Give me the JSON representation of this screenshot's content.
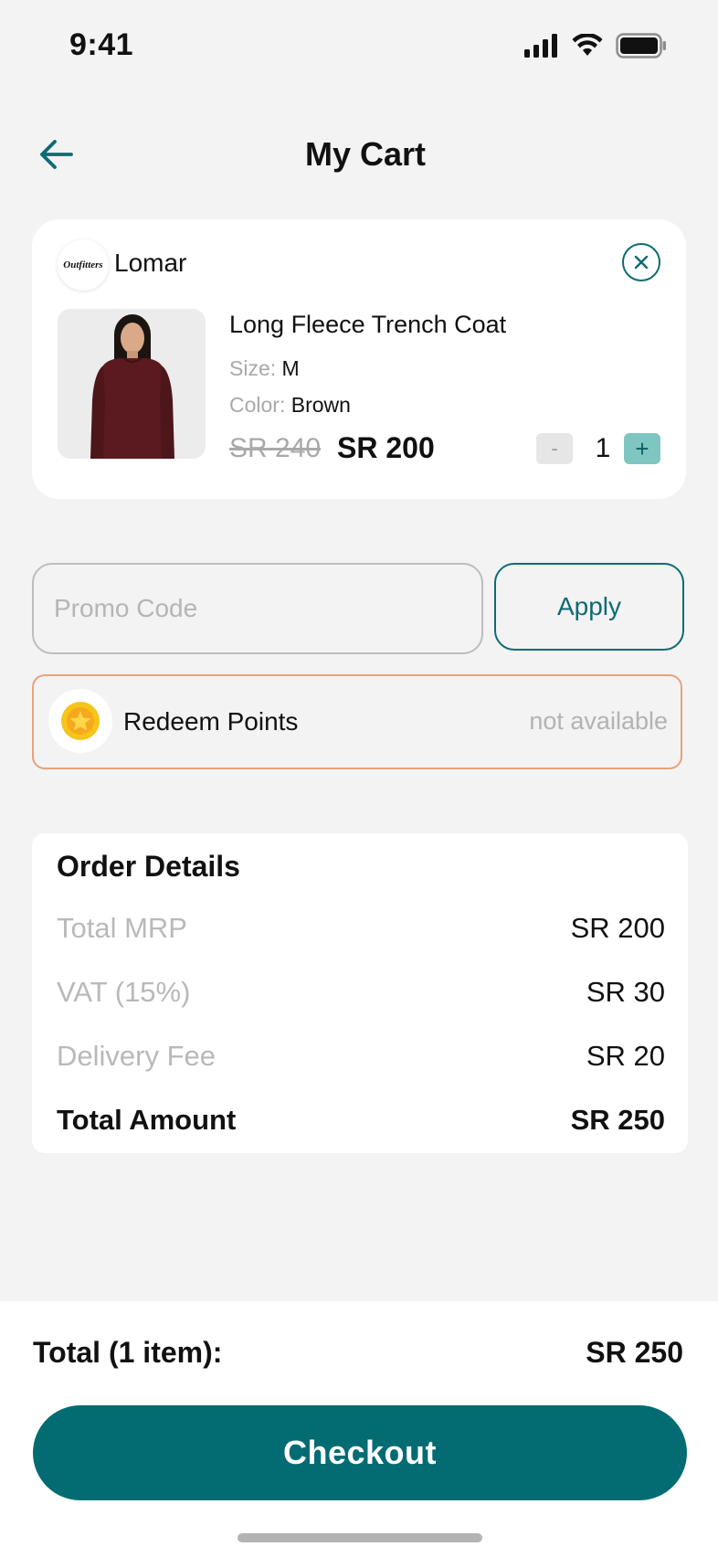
{
  "status_bar": {
    "time": "9:41",
    "icons": [
      "cellular-signal-icon",
      "wifi-icon",
      "battery-icon"
    ]
  },
  "header": {
    "title": "My Cart",
    "back_icon": "arrow-left-icon"
  },
  "cart": {
    "store": {
      "logo_text": "Outfitters",
      "name": "Lomar",
      "remove_icon": "close-circle-icon"
    },
    "item": {
      "name": "Long Fleece Trench Coat",
      "size_label": "Size:",
      "size_value": "M",
      "color_label": "Color:",
      "color_value": "Brown",
      "old_price": "SR 240",
      "price": "SR 200",
      "qty_minus": "-",
      "quantity": "1",
      "qty_plus": "+"
    }
  },
  "promo": {
    "placeholder": "Promo Code",
    "value": "",
    "apply_label": "Apply"
  },
  "redeem": {
    "icon": "star-coin-icon",
    "label": "Redeem Points",
    "status": "not available"
  },
  "order_details": {
    "title": "Order Details",
    "rows": [
      {
        "label": "Total MRP",
        "value": "SR 200"
      },
      {
        "label": "VAT (15%)",
        "value": "SR 30"
      },
      {
        "label": "Delivery Fee",
        "value": "SR 20"
      }
    ],
    "total": {
      "label": "Total Amount",
      "value": "SR 250"
    }
  },
  "footer": {
    "total_label": "Total (1 item):",
    "total_value": "SR 250",
    "checkout_label": "Checkout"
  },
  "colors": {
    "accent": "#036c73",
    "accent_light": "#7fc6c2",
    "background": "#f3f3f3",
    "redeem_border": "#e8a27c",
    "coin": "#f5c518"
  }
}
